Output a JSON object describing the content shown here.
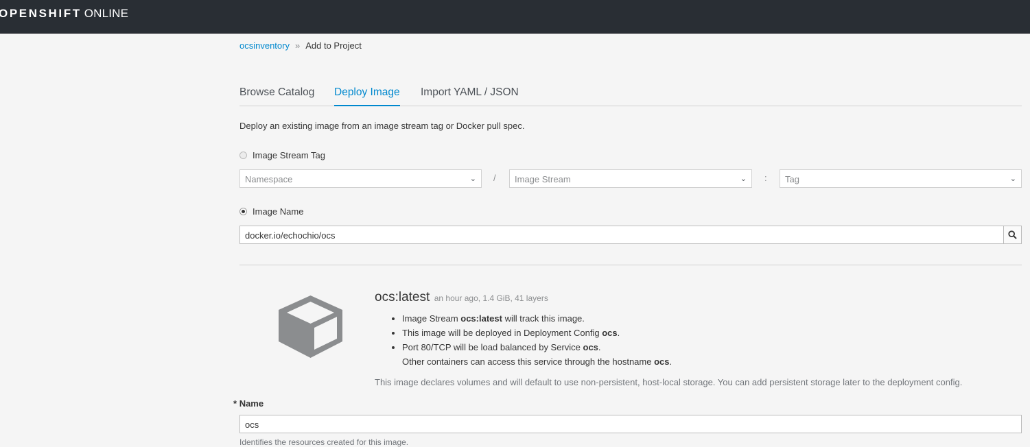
{
  "brand": {
    "strong": "OPENSHIFT",
    "light": "ONLINE"
  },
  "breadcrumb": {
    "project": "ocsinventory",
    "separator": "»",
    "current": "Add to Project"
  },
  "tabs": [
    {
      "label": "Browse Catalog",
      "active": false
    },
    {
      "label": "Deploy Image",
      "active": true
    },
    {
      "label": "Import YAML / JSON",
      "active": false
    }
  ],
  "description": "Deploy an existing image from an image stream tag or Docker pull spec.",
  "image_stream_tag": {
    "label": "Image Stream Tag",
    "checked": false,
    "namespace_placeholder": "Namespace",
    "stream_placeholder": "Image Stream",
    "tag_placeholder": "Tag",
    "sep_slash": "/",
    "sep_colon": ":"
  },
  "image_name": {
    "label": "Image Name",
    "checked": true,
    "value": "docker.io/echochio/ocs"
  },
  "image_info": {
    "name": "ocs:latest",
    "meta": "an hour ago, 1.4 GiB, 41 layers",
    "bullet1_prefix": "Image Stream ",
    "bullet1_bold": "ocs:latest",
    "bullet1_suffix": " will track this image.",
    "bullet2_prefix": "This image will be deployed in Deployment Config ",
    "bullet2_bold": "ocs",
    "bullet2_suffix": ".",
    "bullet3_prefix": "Port 80/TCP will be load balanced by Service ",
    "bullet3_bold": "ocs",
    "bullet3_suffix": ".",
    "bullet3_line2_prefix": "Other containers can access this service through the hostname ",
    "bullet3_line2_bold": "ocs",
    "bullet3_line2_suffix": ".",
    "volume_note": "This image declares volumes and will default to use non-persistent, host-local storage. You can add persistent storage later to the deployment config."
  },
  "name_field": {
    "required_mark": "*",
    "label": "Name",
    "value": "ocs",
    "help": "Identifies the resources created for this image."
  },
  "colors": {
    "accent": "#0088ce",
    "topbar": "#292e34",
    "background": "#f5f5f5"
  },
  "icons": {
    "image": "cube-icon",
    "search": "search-icon",
    "dropdown": "chevron-down-icon"
  }
}
